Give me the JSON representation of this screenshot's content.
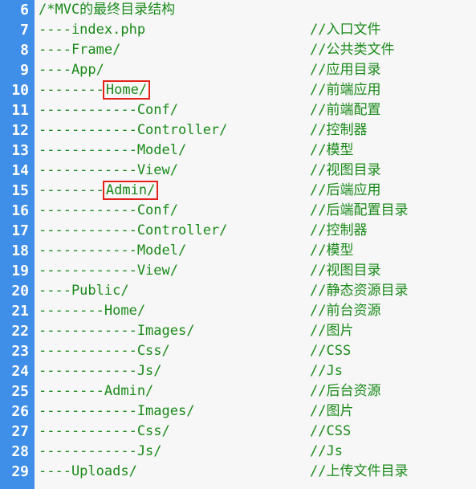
{
  "lines": [
    {
      "num": "6",
      "path": "/*MVC的最终目录结构",
      "comment": ""
    },
    {
      "num": "7",
      "path": "----index.php",
      "comment": "//入口文件"
    },
    {
      "num": "8",
      "path": "----Frame/",
      "comment": "//公共类文件"
    },
    {
      "num": "9",
      "path": "----App/",
      "comment": "//应用目录"
    },
    {
      "num": "10",
      "dashes": "--------",
      "path_hl": "Home/",
      "comment": "//前端应用"
    },
    {
      "num": "11",
      "path": "------------Conf/",
      "comment": "//前端配置"
    },
    {
      "num": "12",
      "path": "------------Controller/",
      "comment": "//控制器"
    },
    {
      "num": "13",
      "path": "------------Model/",
      "comment": "//模型"
    },
    {
      "num": "14",
      "path": "------------View/",
      "comment": "//视图目录"
    },
    {
      "num": "15",
      "dashes": "--------",
      "path_hl": "Admin/",
      "comment": "//后端应用"
    },
    {
      "num": "16",
      "path": "------------Conf/",
      "comment": "//后端配置目录"
    },
    {
      "num": "17",
      "path": "------------Controller/",
      "comment": "//控制器"
    },
    {
      "num": "18",
      "path": "------------Model/",
      "comment": "//模型"
    },
    {
      "num": "19",
      "path": "------------View/",
      "comment": "//视图目录"
    },
    {
      "num": "20",
      "path": "----Public/",
      "comment": "//静态资源目录"
    },
    {
      "num": "21",
      "path": "--------Home/",
      "comment": "//前台资源"
    },
    {
      "num": "22",
      "path": "------------Images/",
      "comment": "//图片"
    },
    {
      "num": "23",
      "path": "------------Css/",
      "comment": "//CSS"
    },
    {
      "num": "24",
      "path": "------------Js/",
      "comment": "//Js"
    },
    {
      "num": "25",
      "path": "--------Admin/",
      "comment": "//后台资源"
    },
    {
      "num": "26",
      "path": "------------Images/",
      "comment": "//图片"
    },
    {
      "num": "27",
      "path": "------------Css/",
      "comment": "//CSS"
    },
    {
      "num": "28",
      "path": "------------Js/",
      "comment": "//Js"
    },
    {
      "num": "29",
      "path": "----Uploads/",
      "comment": "//上传文件目录"
    }
  ],
  "colors": {
    "gutter": "#3f8ee8",
    "text": "#1a8a1a",
    "highlight_border": "#e3221b"
  }
}
